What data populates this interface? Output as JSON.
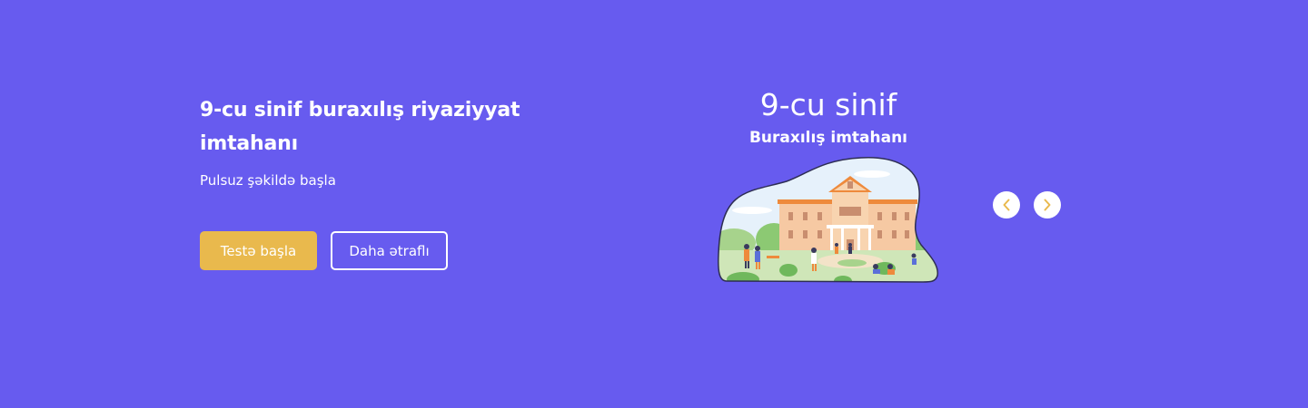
{
  "hero": {
    "title": "9-cu sinif buraxılış riyaziyyat imtahanı",
    "subtitle": "Pulsuz şəkildə başla",
    "primary_button": "Testə başla",
    "secondary_button": "Daha ətraflı"
  },
  "slide": {
    "title": "9-cu sinif",
    "subtitle": "Buraxılış imtahanı",
    "illustration": "school-building-illustration"
  },
  "carousel": {
    "prev_icon": "chevron-left-icon",
    "next_icon": "chevron-right-icon"
  },
  "colors": {
    "background": "#675BEF",
    "accent": "#E9B94D",
    "text": "#FFFFFF"
  }
}
